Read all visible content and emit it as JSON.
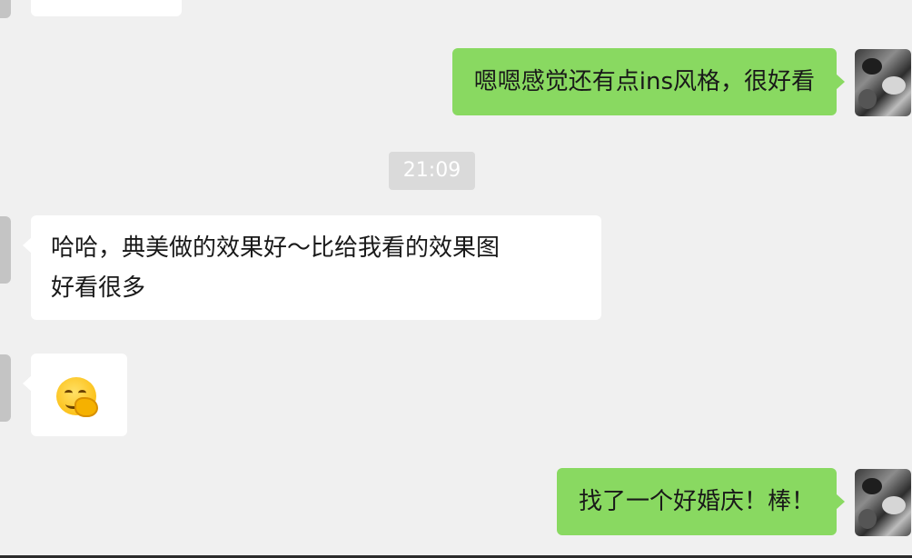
{
  "messages": [
    {
      "direction": "outgoing",
      "text": "嗯嗯感觉还有点ins风格，很好看"
    },
    {
      "direction": "incoming",
      "text": "哈哈，典美做的效果好～比给我看的效果图好看很多"
    },
    {
      "direction": "incoming",
      "emoji": "hand-over-mouth-emoji"
    },
    {
      "direction": "outgoing",
      "text": "找了一个好婚庆！棒！"
    }
  ],
  "timestamp": "21:09",
  "colors": {
    "background": "#f0f0f0",
    "outgoing_bubble": "#89d961",
    "incoming_bubble": "#ffffff",
    "timestamp_bg": "#dadada"
  },
  "lines": {
    "m1_line1": "哈哈，典美做的效果好～比给我看的效果图",
    "m1_line2": "好看很多"
  }
}
